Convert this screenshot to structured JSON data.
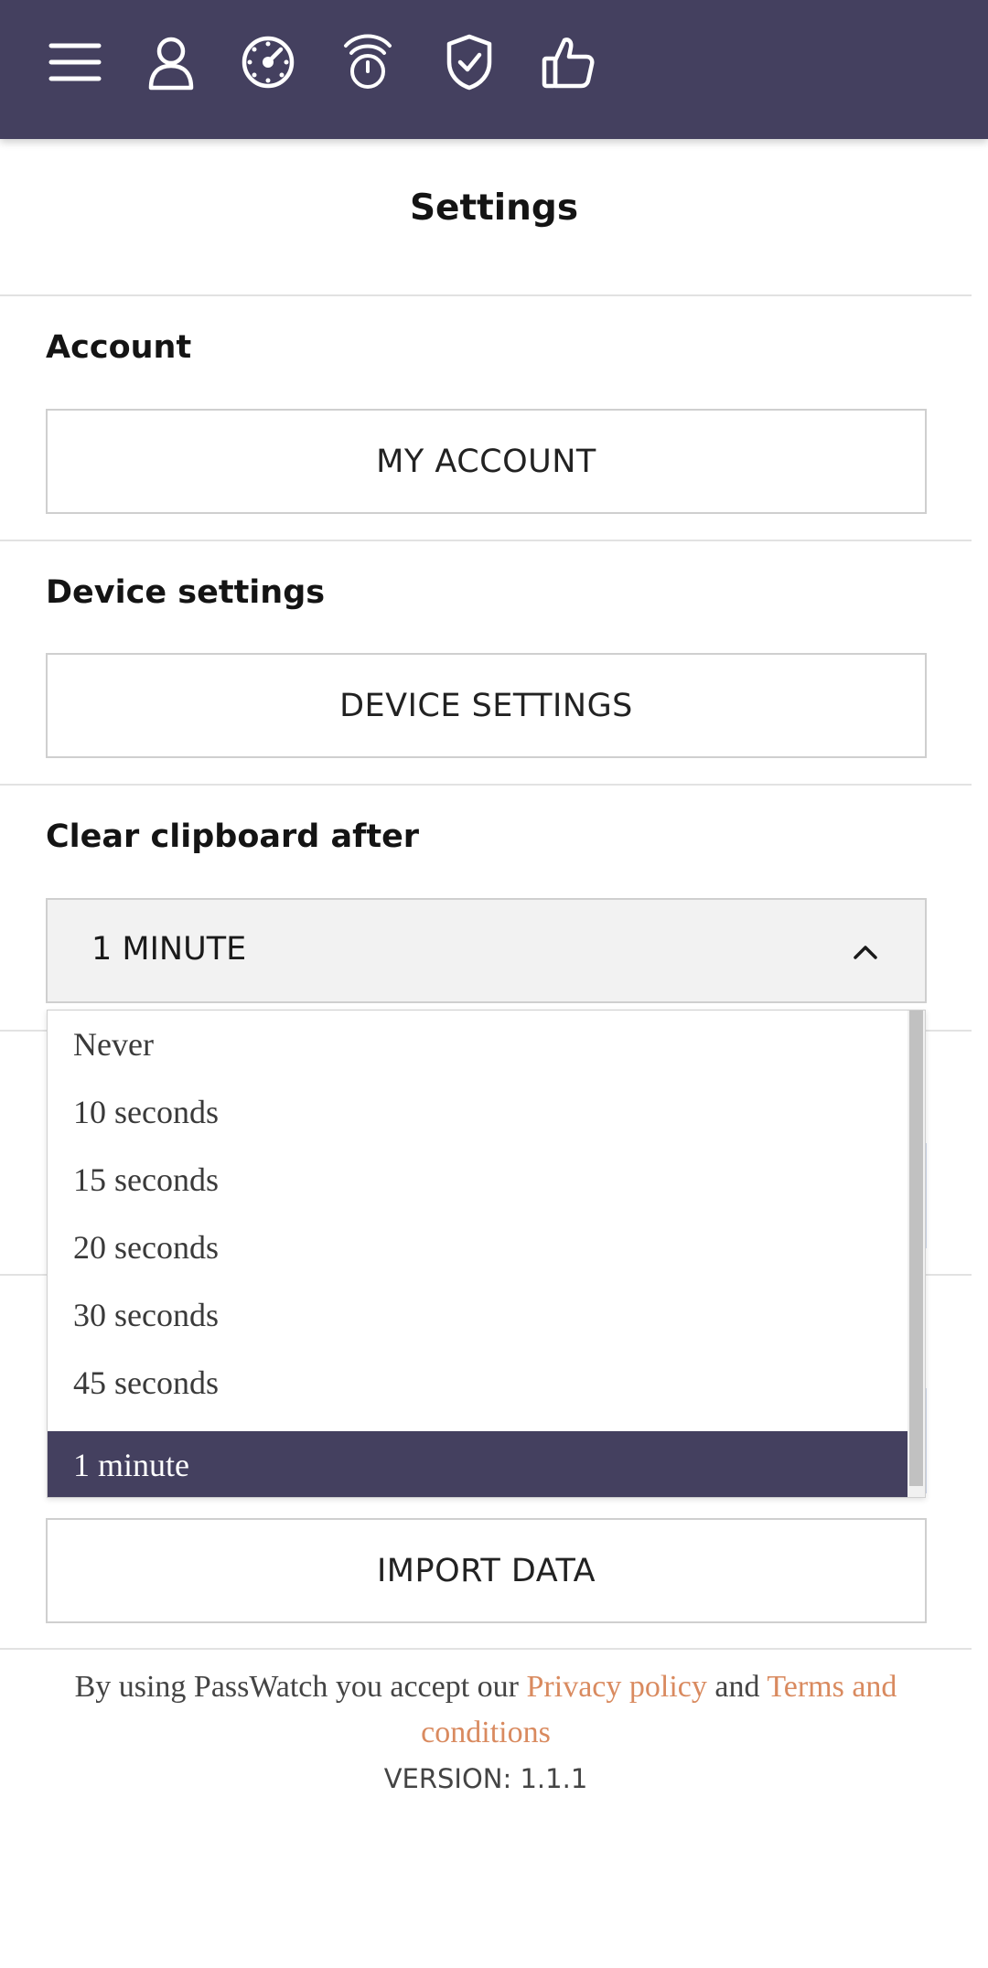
{
  "toolbar": {
    "icons": [
      "menu-icon",
      "user-icon",
      "dashboard-icon",
      "timer-icon",
      "shield-check-icon",
      "thumbs-up-icon"
    ],
    "color": "#44405f"
  },
  "page": {
    "title": "Settings"
  },
  "account": {
    "label": "Account",
    "button": "MY ACCOUNT"
  },
  "device": {
    "label": "Device settings",
    "button": "DEVICE SETTINGS"
  },
  "clipboard": {
    "label": "Clear clipboard after",
    "selected": "1 MINUTE",
    "options": [
      "Never",
      "10 seconds",
      "15 seconds",
      "20 seconds",
      "30 seconds",
      "45 seconds",
      "1 minute"
    ],
    "selected_option_index": 6
  },
  "import": {
    "button": "IMPORT DATA"
  },
  "footer": {
    "legal_prefix": "By using PassWatch you accept our",
    "privacy_link": "Privacy policy",
    "and": "and",
    "terms_link": "Terms and conditions",
    "version": "VERSION: 1.1.1",
    "link_color": "#d98a5f"
  }
}
